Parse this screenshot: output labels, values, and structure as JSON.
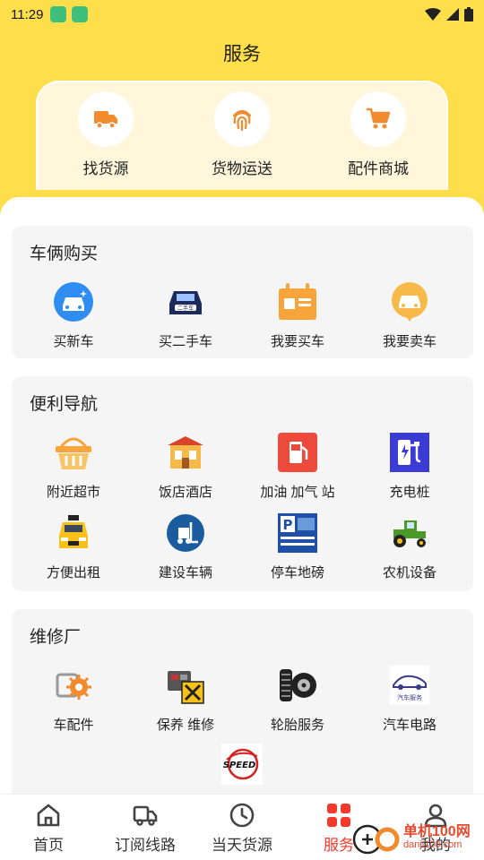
{
  "status_bar": {
    "time": "11:29"
  },
  "header": {
    "title": "服务"
  },
  "top_services": [
    {
      "label": "找货源",
      "icon": "truck-icon"
    },
    {
      "label": "货物运送",
      "icon": "fingerprint-icon"
    },
    {
      "label": "配件商城",
      "icon": "cart-icon"
    }
  ],
  "sections": {
    "car_purchase": {
      "title": "车俩购买",
      "items": [
        {
          "label": "买新车",
          "icon": "new-car-icon"
        },
        {
          "label": "买二手车",
          "icon": "used-car-icon"
        },
        {
          "label": "我要买车",
          "icon": "calendar-card-icon"
        },
        {
          "label": "我要卖车",
          "icon": "sell-car-icon"
        }
      ]
    },
    "navigation": {
      "title": "便利导航",
      "items": [
        {
          "label": "附近超市",
          "icon": "basket-icon"
        },
        {
          "label": "饭店酒店",
          "icon": "restaurant-icon"
        },
        {
          "label": "加油 加气 站",
          "icon": "fuel-icon"
        },
        {
          "label": "充电桩",
          "icon": "charging-icon"
        },
        {
          "label": "方便出租",
          "icon": "taxi-icon"
        },
        {
          "label": "建设车辆",
          "icon": "forklift-icon"
        },
        {
          "label": "停车地磅",
          "icon": "parking-icon"
        },
        {
          "label": "农机设备",
          "icon": "tractor-icon"
        }
      ]
    },
    "repair": {
      "title": "维修厂",
      "items": [
        {
          "label": "车配件",
          "icon": "gear-icon"
        },
        {
          "label": "保养 维修",
          "icon": "engine-tools-icon"
        },
        {
          "label": "轮胎服务",
          "icon": "tire-icon"
        },
        {
          "label": "汽车电路",
          "icon": "car-logo-icon",
          "icon_text": "汽车服务"
        },
        {
          "label": "",
          "icon": "speed-logo-icon",
          "icon_text": "SPEED"
        }
      ]
    }
  },
  "bottom_nav": [
    {
      "label": "首页",
      "icon": "home-icon"
    },
    {
      "label": "订阅线路",
      "icon": "truck-outline-icon"
    },
    {
      "label": "当天货源",
      "icon": "clock-icon"
    },
    {
      "label": "服务",
      "icon": "grid-icon",
      "active": true
    },
    {
      "label": "我的",
      "icon": "user-icon"
    }
  ],
  "watermark": {
    "text": "单机100网",
    "sub": "danji100.com"
  },
  "colors": {
    "header": "#ffde4c",
    "accent": "#f2392b",
    "orange": "#f28a2e"
  }
}
